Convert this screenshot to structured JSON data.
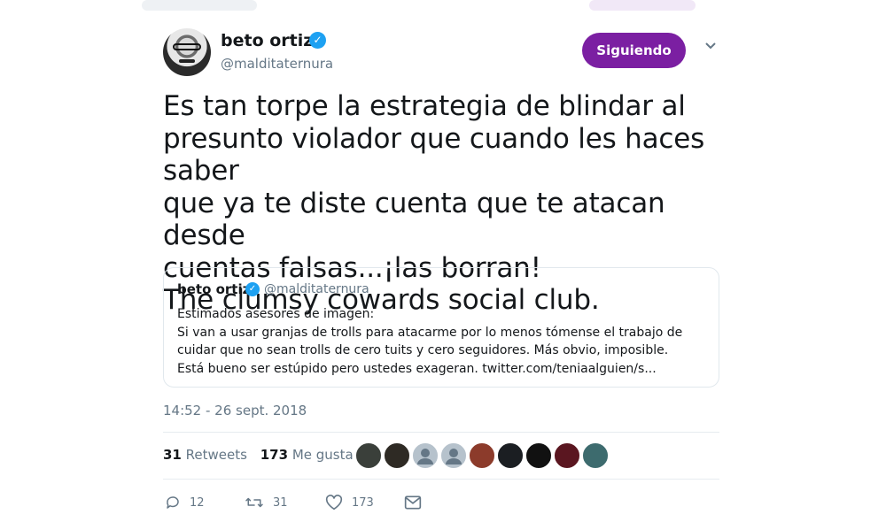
{
  "author": {
    "name": "beto ortiz",
    "handle": "@malditaternura",
    "follow_label": "Siguiendo"
  },
  "tweet_text": "Es tan torpe la estrategia de blindar al\npresunto violador que cuando les haces saber\nque ya te diste cuenta que te atacan desde\ncuentas falsas...¡las borran!\nThe clumsy cowards social club.",
  "quoted": {
    "name": "beto ortiz",
    "handle": "@malditaternura",
    "lines": [
      "Estimados asesores de imagen:",
      "Si van a usar granjas de trolls para atacarme por lo menos tómense el trabajo de",
      "cuidar que no sean trolls de cero tuits y cero seguidores. Más obvio, imposible.",
      "Está bueno ser estúpido pero ustedes exageran. twitter.com/teniaalguien/s..."
    ]
  },
  "timestamp": "14:52 - 26 sept. 2018",
  "stats": {
    "retweets_count": "31",
    "retweets_label": "Retweets",
    "likes_count": "173",
    "likes_label": "Me gusta"
  },
  "likers": [
    {
      "icon": "liker-avatar",
      "color": "#3a3f3a"
    },
    {
      "icon": "liker-avatar",
      "color": "#2e2a24"
    },
    {
      "icon": "default-avatar",
      "color": "#b6c2cc"
    },
    {
      "icon": "default-avatar",
      "color": "#b6c2cc"
    },
    {
      "icon": "liker-avatar",
      "color": "#8c3b2b"
    },
    {
      "icon": "liker-avatar",
      "color": "#1b1e22"
    },
    {
      "icon": "liker-avatar",
      "color": "#111111"
    },
    {
      "icon": "liker-avatar",
      "color": "#5a1620"
    },
    {
      "icon": "liker-avatar",
      "color": "#3d6b6e"
    }
  ],
  "actions": {
    "reply_count": "12",
    "retweet_count": "31",
    "like_count": "173"
  },
  "colors": {
    "follow_button": "#7b1fa2",
    "verified": "#1da1f2",
    "secondary_text": "#657786"
  }
}
